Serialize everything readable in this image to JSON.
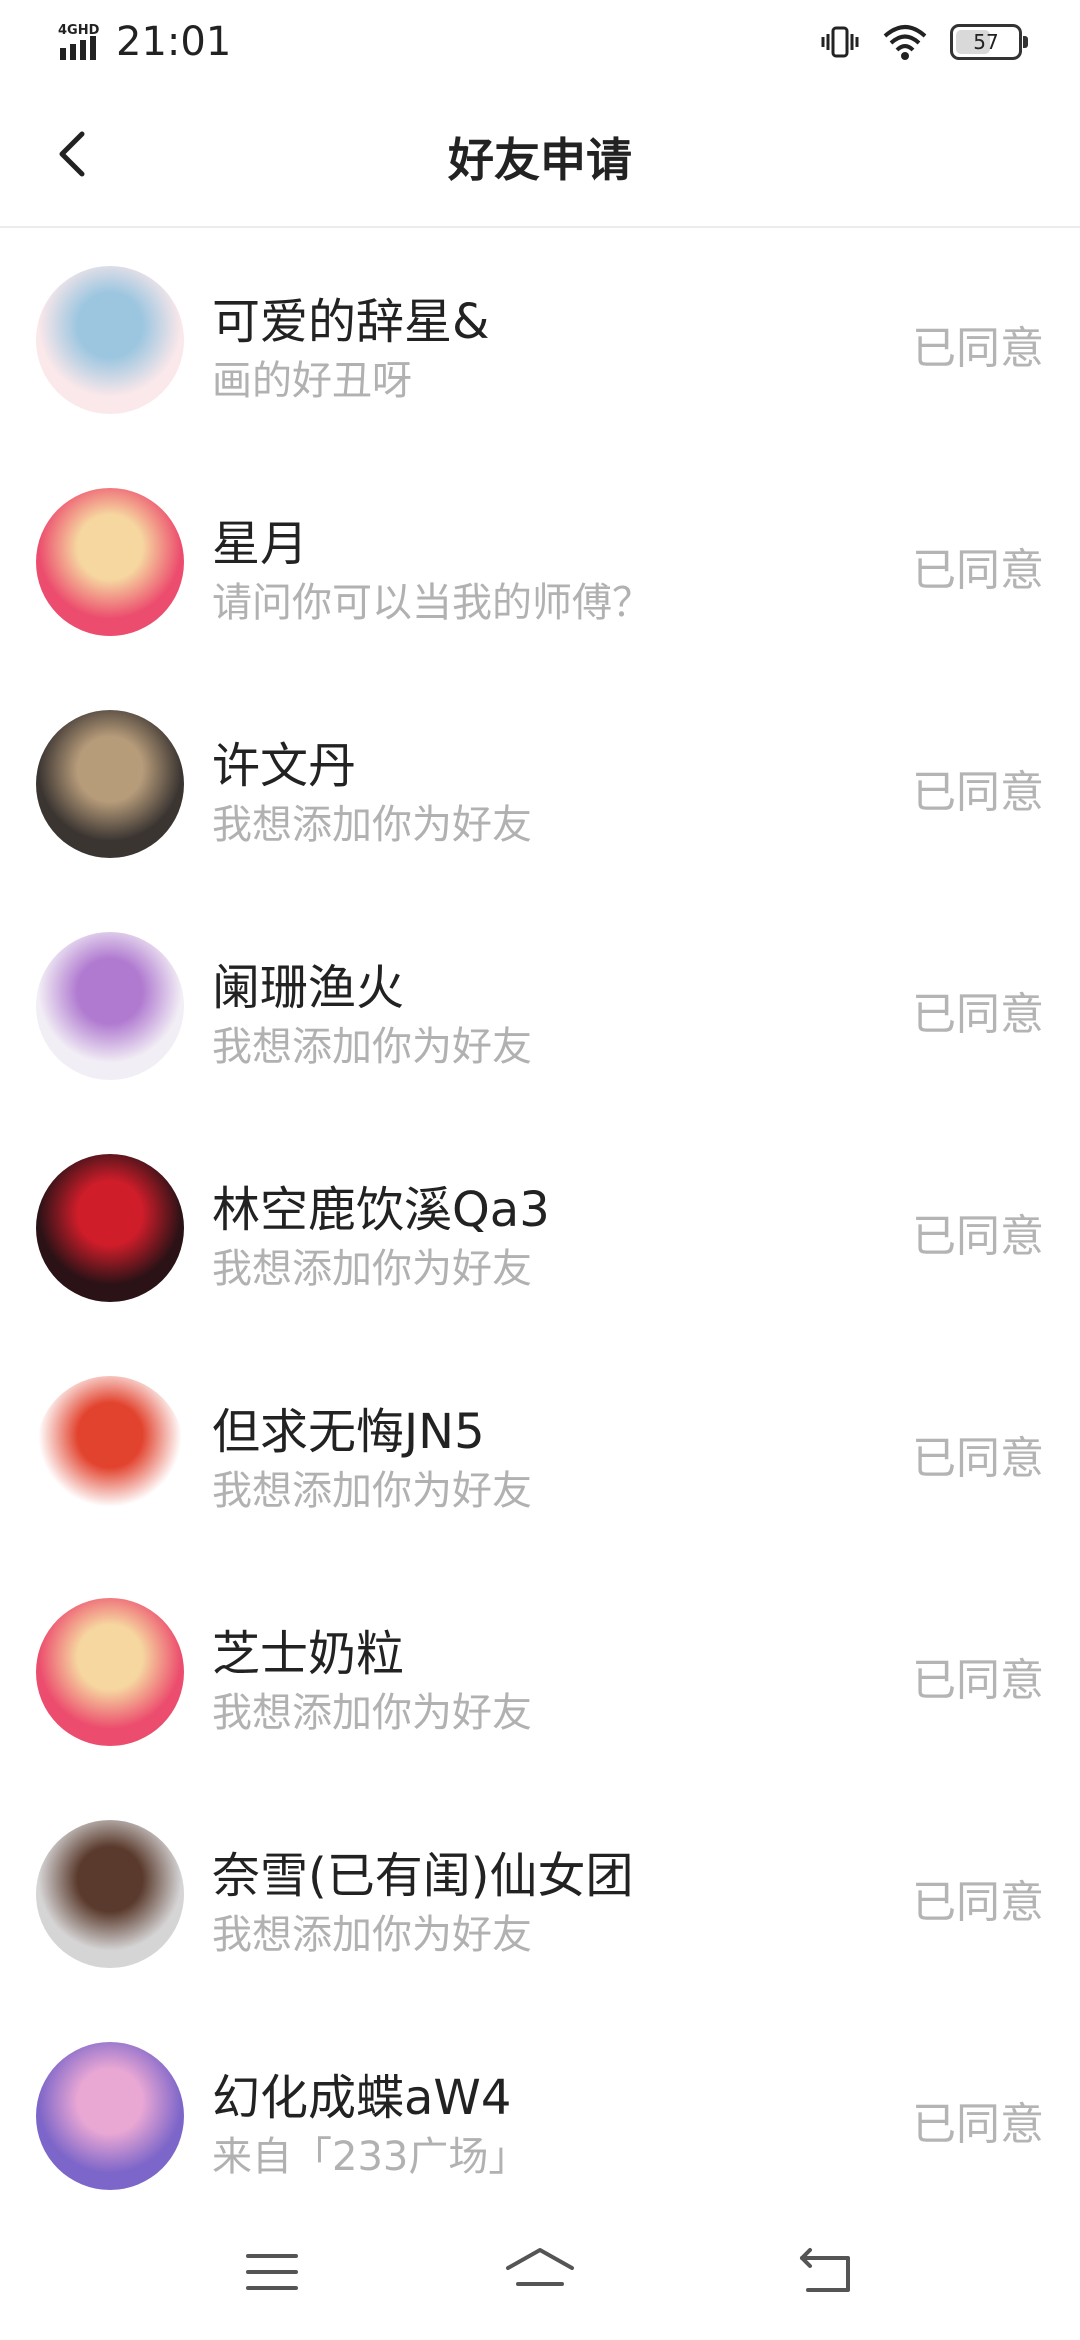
{
  "status_bar": {
    "network": "4GHD",
    "time": "21:01",
    "battery": "57",
    "battery_level_percent": 57,
    "icons": [
      "signal-icon",
      "vibrate-icon",
      "wifi-icon",
      "battery-icon"
    ]
  },
  "header": {
    "title": "好友申请",
    "back_icon": "chevron-left-icon"
  },
  "requests": [
    {
      "name": "可爱的辞星&",
      "message": "画的好丑呀",
      "status": "已同意",
      "avatar_colors": [
        "#fbe8ea",
        "#9cc6e0"
      ]
    },
    {
      "name": "星月",
      "message": "请问你可以当我的师傅？",
      "status": "已同意",
      "avatar_colors": [
        "#ec4c6d",
        "#f6d7a0"
      ]
    },
    {
      "name": "许文丹",
      "message": "我想添加你为好友",
      "status": "已同意",
      "avatar_colors": [
        "#3b3532",
        "#b79c7a"
      ]
    },
    {
      "name": "阑珊渔火",
      "message": "我想添加你为好友",
      "status": "已同意",
      "avatar_colors": [
        "#f2eef5",
        "#b07ad0"
      ]
    },
    {
      "name": "林空鹿饮溪Qa3",
      "message": "我想添加你为好友",
      "status": "已同意",
      "avatar_colors": [
        "#2a1216",
        "#cf1d2a"
      ]
    },
    {
      "name": "但求无悔JN5",
      "message": "我想添加你为好友",
      "status": "已同意",
      "avatar_colors": [
        "#ffffff",
        "#e2432e"
      ]
    },
    {
      "name": "芝士奶粒",
      "message": "我想添加你为好友",
      "status": "已同意",
      "avatar_colors": [
        "#ec4c6d",
        "#f6d7a0"
      ]
    },
    {
      "name": "奈雪(已有闺)仙女团",
      "message": "我想添加你为好友",
      "status": "已同意",
      "avatar_colors": [
        "#d6d5d6",
        "#5a3a2c"
      ]
    },
    {
      "name": "幻化成蝶aW4",
      "message": "来自「233广场」",
      "status": "已同意",
      "avatar_colors": [
        "#7d66c9",
        "#e9a7d4"
      ]
    }
  ],
  "nav_bar": {
    "icons": [
      "menu-icon",
      "home-icon",
      "back-icon"
    ]
  }
}
